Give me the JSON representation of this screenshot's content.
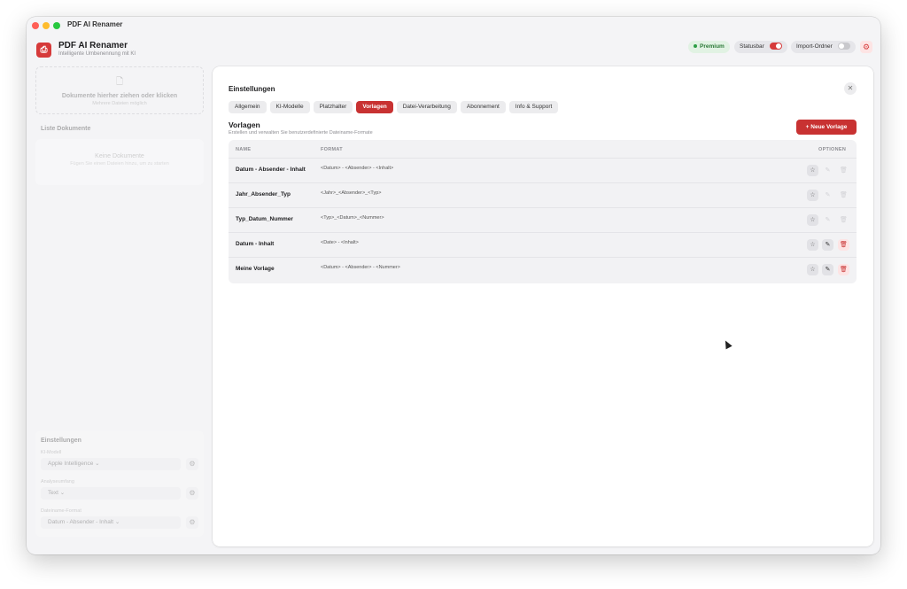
{
  "window": {
    "title": "PDF AI Renamer"
  },
  "app": {
    "name": "PDF AI Renamer",
    "subtitle": "Intelligente Umbenennung mit KI",
    "icon": "pdf-icon"
  },
  "header": {
    "premium_label": "Premium",
    "statusbar_label": "Statusbar",
    "statusbar_on": true,
    "import_label": "Import-Ordner",
    "import_on": false
  },
  "sidebar": {
    "dropzone_title": "Dokumente hierher ziehen oder klicken",
    "dropzone_sub": "Mehrere Dateien möglich",
    "list_title": "Liste Dokumente",
    "empty_title": "Keine Dokumente",
    "empty_sub": "Fügen Sie einen Dateien hinzu, um zu starten",
    "settings_title": "Einstellungen",
    "ki_label": "KI-Modell",
    "ki_value": "Apple Intelligence",
    "scope_label": "Analyseumfang",
    "scope_value": "Text",
    "format_label": "Dateiname-Format",
    "format_value": "Datum - Absender - Inhalt"
  },
  "panel": {
    "title": "Einstellungen",
    "tabs": [
      {
        "label": "Allgemein",
        "active": false
      },
      {
        "label": "KI-Modelle",
        "active": false
      },
      {
        "label": "Platzhalter",
        "active": false
      },
      {
        "label": "Vorlagen",
        "active": true
      },
      {
        "label": "Datei-Verarbeitung",
        "active": false
      },
      {
        "label": "Abonnement",
        "active": false
      },
      {
        "label": "Info & Support",
        "active": false
      }
    ],
    "section_title": "Vorlagen",
    "section_sub": "Erstellen und verwalten Sie benutzerdefinierte Dateiname-Formate",
    "new_button": "+  Neue Vorlage",
    "columns": {
      "name": "NAME",
      "format": "FORMAT",
      "options": "OPTIONEN"
    },
    "rows": [
      {
        "name": "Datum - Absender - Inhalt",
        "format": "<Datum> - <Absender> - <Inhalt>",
        "editable": false
      },
      {
        "name": "Jahr_Absender_Typ",
        "format": "<Jahr>_<Absender>_<Typ>",
        "editable": false
      },
      {
        "name": "Typ_Datum_Nummer",
        "format": "<Typ>_<Datum>_<Nummer>",
        "editable": false
      },
      {
        "name": "Datum - Inhalt",
        "format": "<Date> - <Inhalt>",
        "editable": true
      },
      {
        "name": "Meine Vorlage",
        "format": "<Datum> - <Absender> - <Nummer>",
        "editable": true
      }
    ]
  },
  "colors": {
    "accent": "#c83232",
    "premium_bg": "#e1f2e3",
    "premium_fg": "#2c7a38"
  }
}
